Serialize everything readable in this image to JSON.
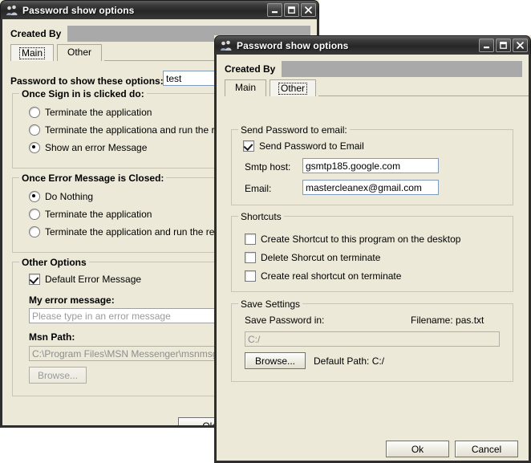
{
  "back_window": {
    "title": "Password show options",
    "icon": "users-icon",
    "title_buttons": {
      "minimize": "minimize-icon",
      "maximize": "maximize-icon",
      "close": "close-icon"
    },
    "created_by_label": "Created By",
    "created_by_value": "",
    "tabs": [
      {
        "label": "Main",
        "selected": true
      },
      {
        "label": "Other",
        "selected": false
      }
    ],
    "password_label": "Password to show these options:",
    "password_value": "test",
    "sign_in_group": {
      "title": "Once Sign in is clicked do:",
      "options": [
        {
          "label": "Terminate the application",
          "checked": false
        },
        {
          "label": "Terminate the applicationa and run the real msn",
          "checked": false
        },
        {
          "label": "Show an error Message",
          "checked": true
        }
      ]
    },
    "error_closed_group": {
      "title": "Once Error Message is Closed:",
      "options": [
        {
          "label": "Do Nothing",
          "checked": true
        },
        {
          "label": "Terminate the application",
          "checked": false
        },
        {
          "label": "Terminate the application and run the real msn",
          "checked": false
        }
      ]
    },
    "other_options_group": {
      "title": "Other Options",
      "default_error_checkbox": {
        "label": "Default Error Message",
        "checked": true
      },
      "my_error_label": "My error message:",
      "my_error_placeholder": "Please type in an error message",
      "my_error_value": "",
      "msn_path_label": "Msn Path:",
      "msn_path_value": "C:\\Program Files\\MSN Messenger\\msnmsgr.exe",
      "browse_label": "Browse..."
    },
    "ok_label": "Ok"
  },
  "front_window": {
    "title": "Password show options",
    "icon": "users-icon",
    "title_buttons": {
      "minimize": "minimize-icon",
      "maximize": "maximize-icon",
      "close": "close-icon"
    },
    "created_by_label": "Created By",
    "created_by_value": "",
    "tabs": [
      {
        "label": "Main",
        "selected": false
      },
      {
        "label": "Other",
        "selected": true
      }
    ],
    "email_group": {
      "title": "Send Password to email:",
      "send_checkbox": {
        "label": "Send Password to Email",
        "checked": true
      },
      "smtp_label": "Smtp host:",
      "smtp_value": "gsmtp185.google.com",
      "email_label": "Email:",
      "email_value": "mastercleanex@gmail.com"
    },
    "shortcuts_group": {
      "title": "Shortcuts",
      "items": [
        {
          "label": "Create Shortcut to this program on the desktop",
          "checked": false
        },
        {
          "label": "Delete Shorcut on terminate",
          "checked": false
        },
        {
          "label": "Create real shortcut on terminate",
          "checked": false
        }
      ]
    },
    "save_group": {
      "title": "Save Settings",
      "save_in_label": "Save Password in:",
      "filename_label": "Filename: pas.txt",
      "path_value": "C:/",
      "browse_label": "Browse...",
      "default_path_label": "Default Path: C:/"
    },
    "ok_label": "Ok",
    "cancel_label": "Cancel"
  },
  "colors": {
    "window_face": "#ece9d8",
    "titlebar_dark": "#2b2b2b",
    "redaction_gray": "#a9a9a9",
    "groupbox_border": "#c8c4b8"
  }
}
